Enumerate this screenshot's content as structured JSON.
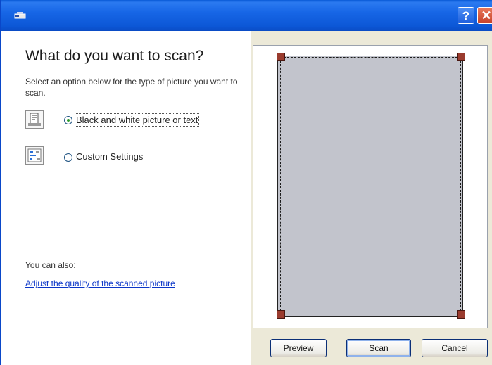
{
  "window": {
    "help_glyph": "?",
    "close_glyph": "✕",
    "titlebar_icon": "scanner-icon"
  },
  "left": {
    "heading": "What do you want to scan?",
    "description": "Select an option below for the type of picture you want to scan.",
    "options": [
      {
        "label": "Black and white picture or text",
        "selected": true,
        "icon": "text-document-icon"
      },
      {
        "label": "Custom Settings",
        "selected": false,
        "icon": "custom-settings-icon"
      }
    ],
    "also_label": "You can also:",
    "adjust_link": "Adjust the quality of the scanned picture"
  },
  "buttons": {
    "preview": "Preview",
    "scan": "Scan",
    "cancel": "Cancel"
  },
  "colors": {
    "titlebar": "#0c57d6",
    "preview_area": "#c2c4cc",
    "handle": "#9a3b2e",
    "link": "#0b36c8"
  }
}
